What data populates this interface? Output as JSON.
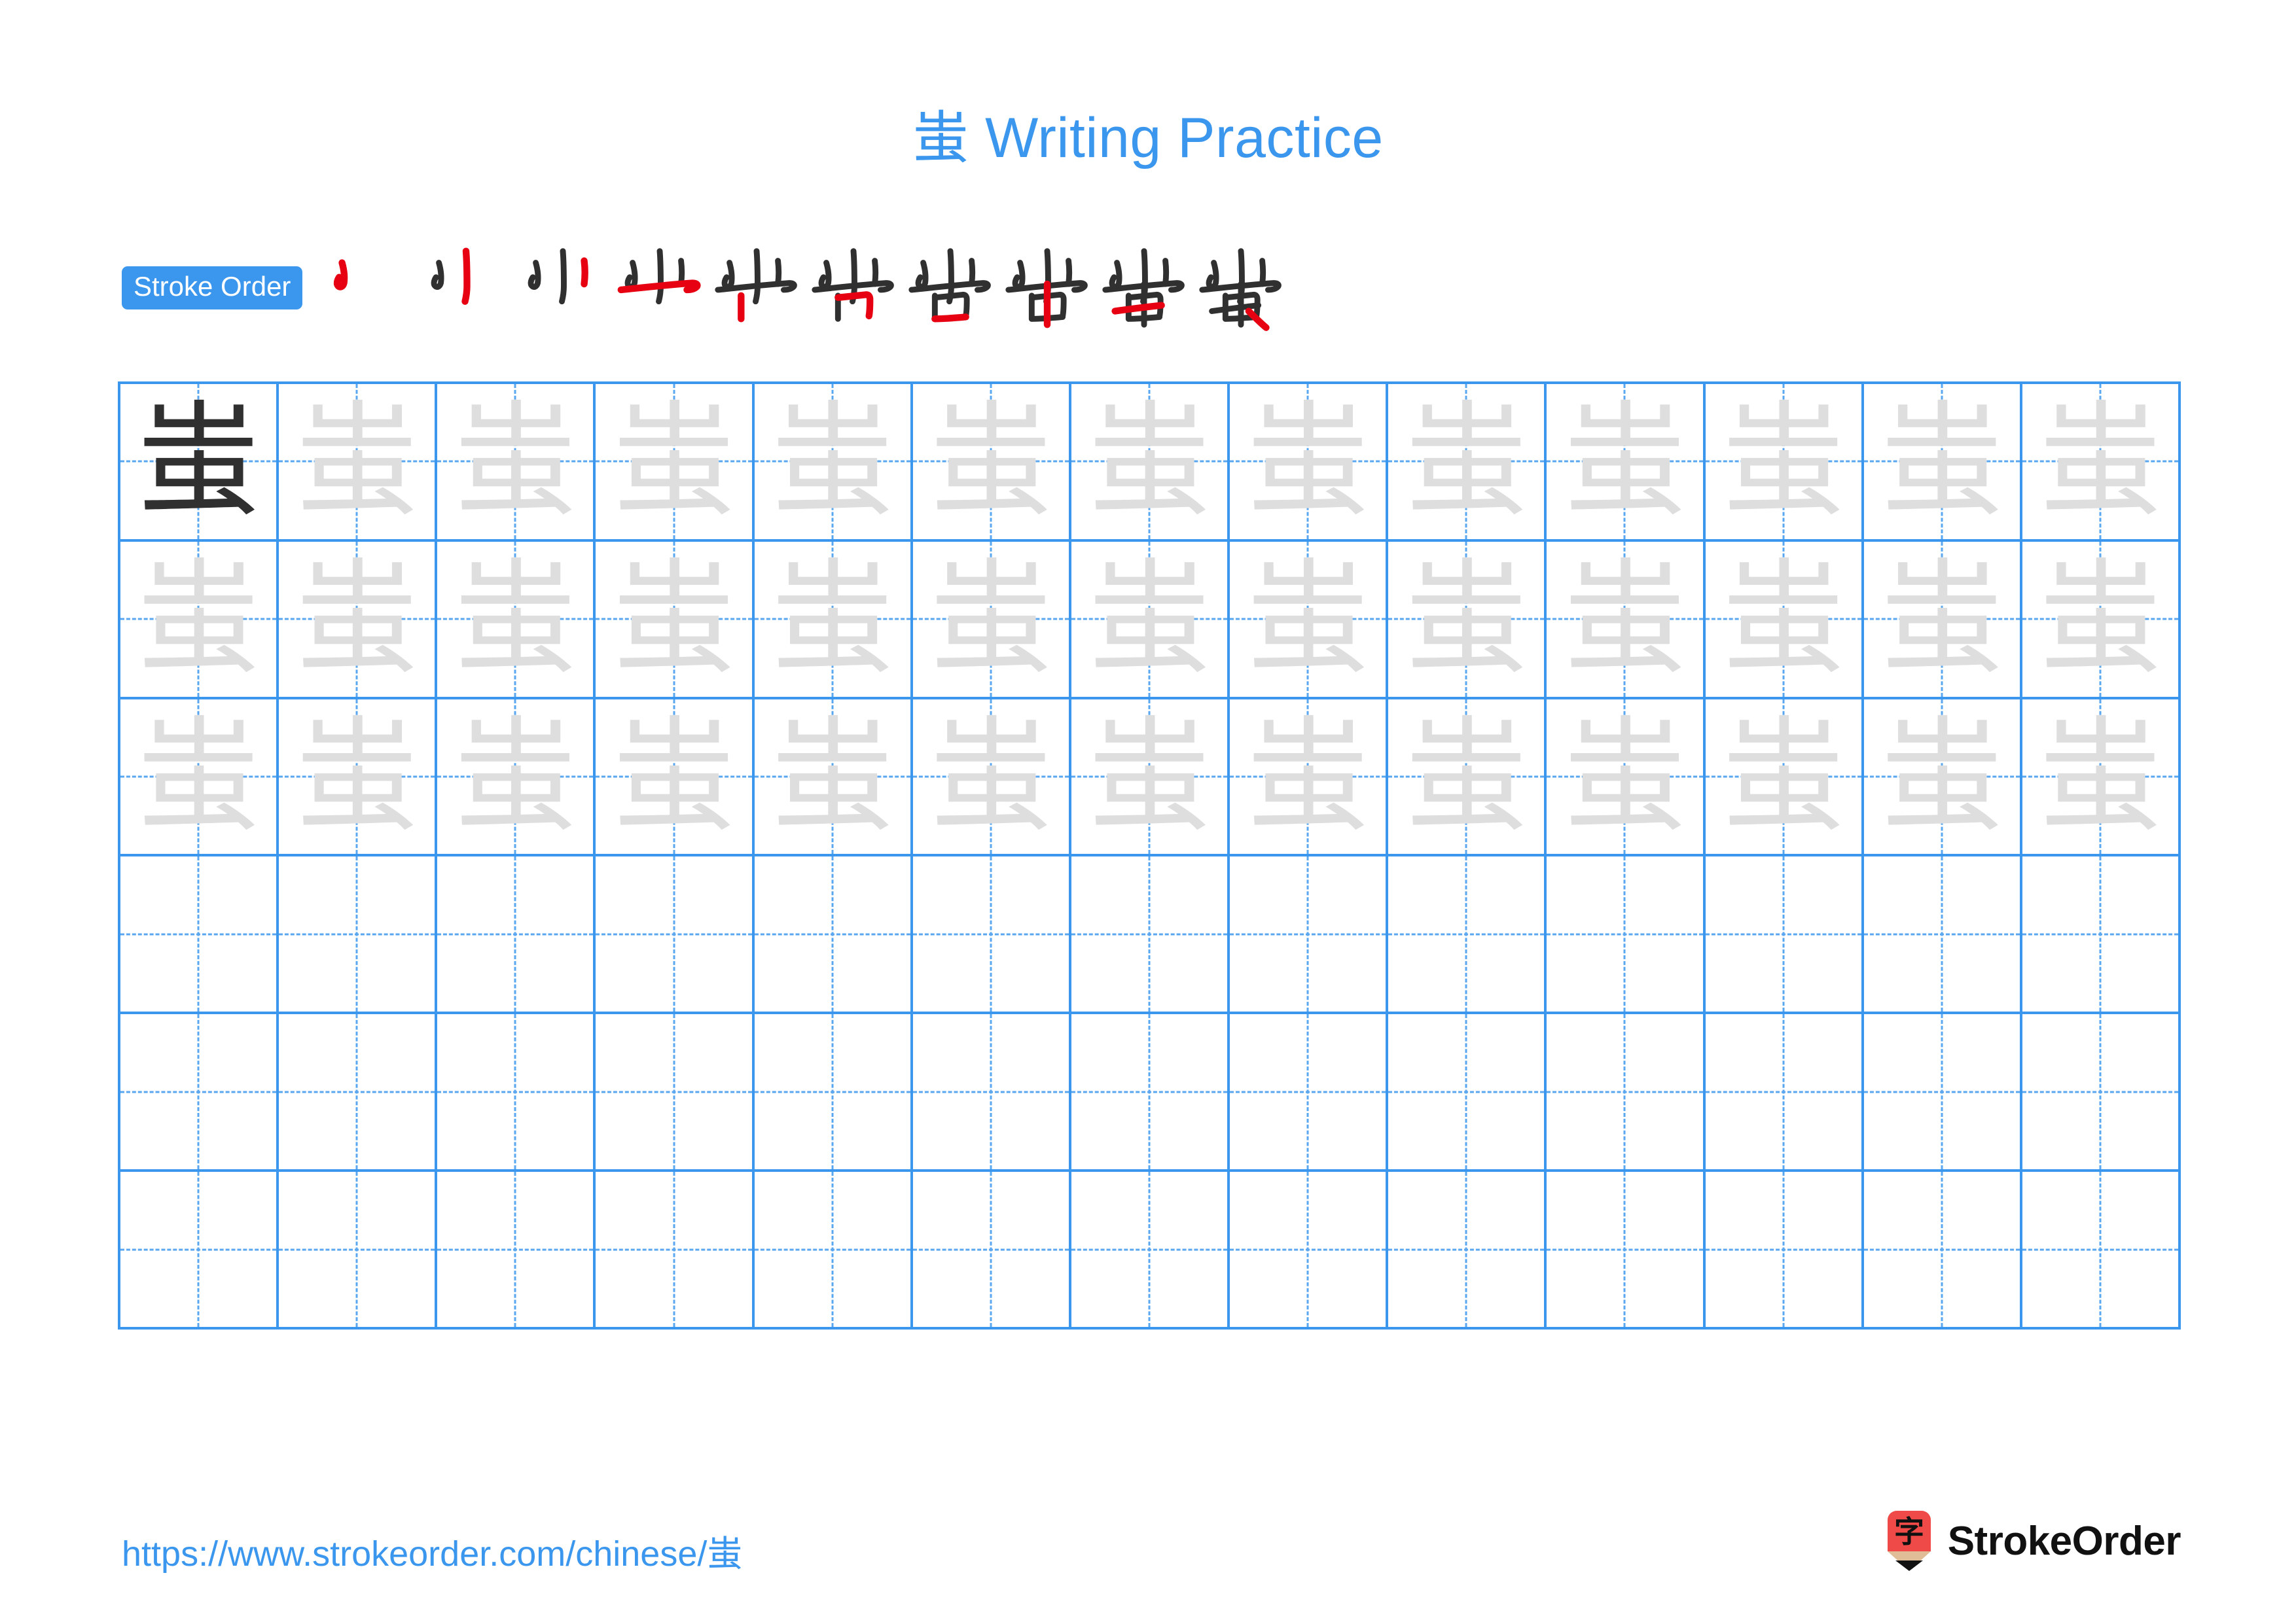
{
  "page": {
    "character": "蚩",
    "title_suffix": " Writing Practice",
    "title_full": "蚩 Writing Practice",
    "background_color": "#ffffff",
    "accent_color": "#3b97ee",
    "stroke_new_color": "#e60012",
    "stroke_done_color": "#303030",
    "trace_color": "#dedede"
  },
  "stroke_order": {
    "badge_label": "Stroke Order",
    "badge_bg": "#3b97ee",
    "badge_text_color": "#ffffff",
    "total_strokes": 10,
    "steps": [
      {
        "index": 1,
        "strokes_drawn": 1,
        "new_stroke": "heng-pie"
      },
      {
        "index": 2,
        "strokes_drawn": 2,
        "new_stroke": "shu"
      },
      {
        "index": 3,
        "strokes_drawn": 3,
        "new_stroke": "shu"
      },
      {
        "index": 4,
        "strokes_drawn": 4,
        "new_stroke": "heng"
      },
      {
        "index": 5,
        "strokes_drawn": 5,
        "new_stroke": "shu"
      },
      {
        "index": 6,
        "strokes_drawn": 6,
        "new_stroke": "heng-zhe"
      },
      {
        "index": 7,
        "strokes_drawn": 7,
        "new_stroke": "heng"
      },
      {
        "index": 8,
        "strokes_drawn": 8,
        "new_stroke": "shu"
      },
      {
        "index": 9,
        "strokes_drawn": 9,
        "new_stroke": "heng"
      },
      {
        "index": 10,
        "strokes_drawn": 10,
        "new_stroke": "dian"
      }
    ]
  },
  "practice_grid": {
    "columns": 13,
    "rows": 6,
    "grid_line_color": "#3b97ee",
    "guide_line_color": "#5aa7f0",
    "cells": [
      [
        "dark",
        "trace",
        "trace",
        "trace",
        "trace",
        "trace",
        "trace",
        "trace",
        "trace",
        "trace",
        "trace",
        "trace",
        "trace"
      ],
      [
        "trace",
        "trace",
        "trace",
        "trace",
        "trace",
        "trace",
        "trace",
        "trace",
        "trace",
        "trace",
        "trace",
        "trace",
        "trace"
      ],
      [
        "trace",
        "trace",
        "trace",
        "trace",
        "trace",
        "trace",
        "trace",
        "trace",
        "trace",
        "trace",
        "trace",
        "trace",
        "trace"
      ],
      [
        "blank",
        "blank",
        "blank",
        "blank",
        "blank",
        "blank",
        "blank",
        "blank",
        "blank",
        "blank",
        "blank",
        "blank",
        "blank"
      ],
      [
        "blank",
        "blank",
        "blank",
        "blank",
        "blank",
        "blank",
        "blank",
        "blank",
        "blank",
        "blank",
        "blank",
        "blank",
        "blank"
      ],
      [
        "blank",
        "blank",
        "blank",
        "blank",
        "blank",
        "blank",
        "blank",
        "blank",
        "blank",
        "blank",
        "blank",
        "blank",
        "blank"
      ]
    ]
  },
  "footer": {
    "url": "https://www.strokeorder.com/chinese/蚩",
    "brand_name": "StrokeOrder",
    "logo_glyph": "字",
    "logo_body_color": "#ef4a47",
    "logo_wood_color": "#e0bd96",
    "logo_tip_color": "#111111"
  }
}
